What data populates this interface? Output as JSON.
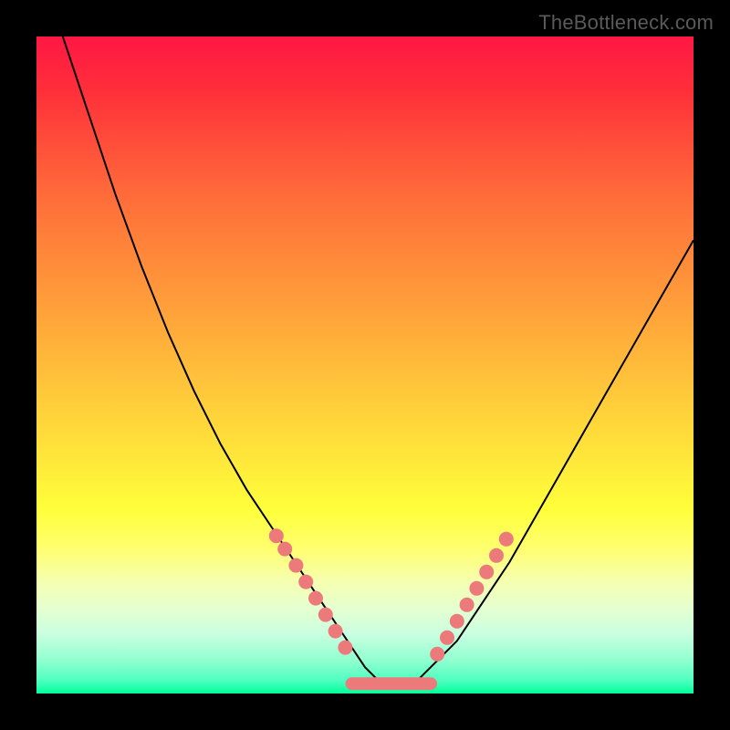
{
  "watermark": "TheBottleneck.com",
  "colors": {
    "background": "#000000",
    "gradient_top": "#ff1744",
    "gradient_bottom": "#00ff99",
    "curve": "#000000",
    "markers": "#ed7a7a"
  },
  "chart_data": {
    "type": "line",
    "title": "",
    "xlabel": "",
    "ylabel": "",
    "xlim": [
      0,
      100
    ],
    "ylim": [
      0,
      100
    ],
    "grid": false,
    "series": [
      {
        "name": "curve",
        "x": [
          4,
          8,
          12,
          16,
          20,
          24,
          28,
          32,
          36,
          40,
          42,
          44,
          46,
          48,
          50,
          52,
          54,
          56,
          58,
          60,
          64,
          68,
          72,
          76,
          80,
          84,
          88,
          92,
          96,
          100
        ],
        "y": [
          100,
          88,
          76,
          65,
          55,
          46,
          38,
          31,
          25,
          19,
          16,
          13,
          10,
          7,
          4,
          2,
          1,
          1,
          2,
          4,
          8,
          14,
          20,
          27,
          34,
          41,
          48,
          55,
          62,
          69
        ]
      }
    ],
    "markers_left": [
      {
        "x": 36.5,
        "y": 24
      },
      {
        "x": 37.8,
        "y": 22
      },
      {
        "x": 39.5,
        "y": 19.5
      },
      {
        "x": 41.0,
        "y": 17
      },
      {
        "x": 42.5,
        "y": 14.5
      },
      {
        "x": 44.0,
        "y": 12
      },
      {
        "x": 45.5,
        "y": 9.5
      },
      {
        "x": 47.0,
        "y": 7
      }
    ],
    "markers_right": [
      {
        "x": 61.0,
        "y": 6
      },
      {
        "x": 62.5,
        "y": 8.5
      },
      {
        "x": 64.0,
        "y": 11
      },
      {
        "x": 65.5,
        "y": 13.5
      },
      {
        "x": 67.0,
        "y": 16
      },
      {
        "x": 68.5,
        "y": 18.5
      },
      {
        "x": 70.0,
        "y": 21
      },
      {
        "x": 71.5,
        "y": 23.5
      }
    ],
    "plateau": {
      "x_start": 48,
      "x_end": 60,
      "y": 1.5
    }
  }
}
